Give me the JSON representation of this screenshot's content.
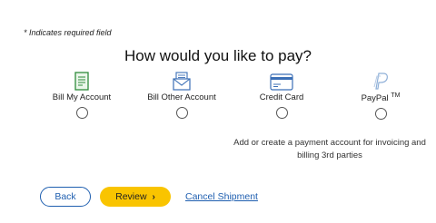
{
  "form": {
    "required_note": "* Indicates required field",
    "heading": "How would you like to pay?"
  },
  "payment_options": [
    {
      "label": "Bill My Account",
      "icon": "document-icon"
    },
    {
      "label": "Bill Other Account",
      "icon": "envelope-icon"
    },
    {
      "label": "Credit Card",
      "icon": "credit-card-icon"
    },
    {
      "label": "PayPal",
      "trademark": "TM",
      "icon": "paypal-icon"
    }
  ],
  "paypal_description": "Add or create a payment account for invoicing and billing 3rd parties",
  "actions": {
    "back_label": "Back",
    "review_label": "Review",
    "cancel_label": "Cancel Shipment"
  },
  "colors": {
    "accent_blue": "#1f5fb0",
    "review_yellow": "#f9c400",
    "icon_green": "#2e8b3a",
    "icon_blue": "#3b6fb6"
  }
}
